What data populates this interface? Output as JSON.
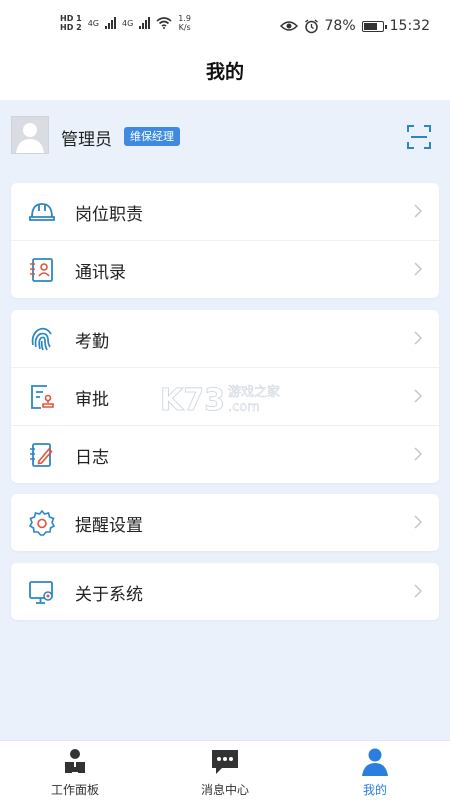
{
  "status_bar": {
    "hd1": "HD 1",
    "hd2": "HD 2",
    "net_type": "4G",
    "net_type2": "4G",
    "speed_value": "1.9",
    "speed_unit": "K/s",
    "battery_percent": "78%",
    "battery_level": 0.78,
    "time": "15:32"
  },
  "header": {
    "title": "我的"
  },
  "profile": {
    "name": "管理员",
    "role": "维保经理"
  },
  "menu_groups": [
    [
      {
        "label": "岗位职责",
        "icon": "helmet-icon"
      },
      {
        "label": "通讯录",
        "icon": "contacts-icon"
      }
    ],
    [
      {
        "label": "考勤",
        "icon": "fingerprint-icon"
      },
      {
        "label": "审批",
        "icon": "approval-icon"
      },
      {
        "label": "日志",
        "icon": "log-icon"
      }
    ],
    [
      {
        "label": "提醒设置",
        "icon": "gear-icon"
      }
    ],
    [
      {
        "label": "关于系统",
        "icon": "monitor-settings-icon"
      }
    ]
  ],
  "watermark": {
    "logo": "K73",
    "site_cn": "游戏之家",
    "site_domain": ".com"
  },
  "tabbar": {
    "items": [
      {
        "label": "工作面板",
        "icon": "workbench-icon"
      },
      {
        "label": "消息中心",
        "icon": "message-icon"
      },
      {
        "label": "我的",
        "icon": "profile-icon"
      }
    ],
    "active_index": 2
  },
  "colors": {
    "accent": "#2a7ee0",
    "badge": "#3d8be0",
    "background": "#eaf1fb",
    "icon": "#2c86c4",
    "icon_red": "#e0533c"
  }
}
